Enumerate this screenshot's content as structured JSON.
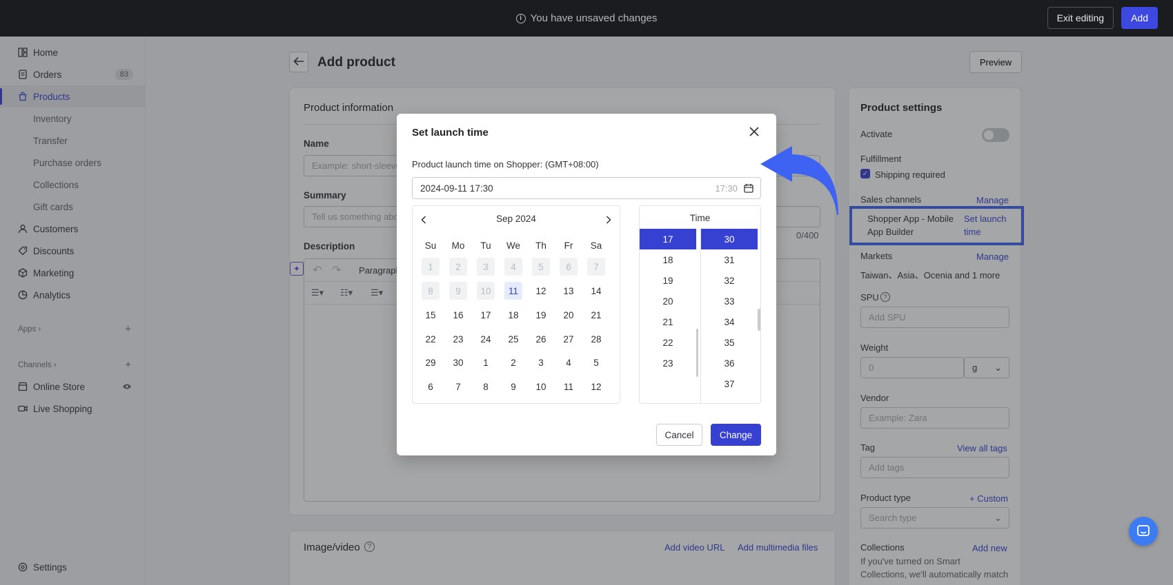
{
  "topbar": {
    "message": "You have unsaved changes",
    "exit_label": "Exit editing",
    "add_label": "Add"
  },
  "sidebar": {
    "items": [
      {
        "label": "Home",
        "icon": "home-icon"
      },
      {
        "label": "Orders",
        "icon": "orders-icon",
        "badge": "83"
      },
      {
        "label": "Products",
        "icon": "bag-icon",
        "active": true
      },
      {
        "label": "Inventory"
      },
      {
        "label": "Transfer"
      },
      {
        "label": "Purchase orders"
      },
      {
        "label": "Collections"
      },
      {
        "label": "Gift cards"
      },
      {
        "label": "Customers",
        "icon": "user-icon"
      },
      {
        "label": "Discounts",
        "icon": "tag-icon"
      },
      {
        "label": "Marketing",
        "icon": "cube-icon"
      },
      {
        "label": "Analytics",
        "icon": "chart-icon"
      }
    ],
    "apps_label": "Apps",
    "channels_label": "Channels",
    "channels": [
      {
        "label": "Online Store",
        "icon": "store-icon"
      },
      {
        "label": "Live Shopping",
        "icon": "video-icon"
      }
    ],
    "settings_label": "Settings"
  },
  "main": {
    "title": "Add product",
    "preview_label": "Preview",
    "product_info": {
      "title": "Product information",
      "name_label": "Name",
      "name_placeholder": "Example: short-sleeve",
      "summary_label": "Summary",
      "summary_placeholder": "Tell us something abo",
      "counter": "0/400",
      "description_label": "Description",
      "paragraph_label": "Paragraph"
    },
    "image_video": {
      "title": "Image/video",
      "add_video_url": "Add video URL",
      "add_multimedia": "Add multimedia files"
    }
  },
  "settings": {
    "title": "Product settings",
    "activate_label": "Activate",
    "fulfillment_label": "Fulfillment",
    "shipping_required": "Shipping required",
    "sales_channels_label": "Sales channels",
    "manage_label": "Manage",
    "channel_name_line1": "Shopper App - Mobile",
    "channel_name_line2": "App Builder",
    "set_launch_line1": "Set launch",
    "set_launch_line2": "time",
    "markets_label": "Markets",
    "markets_manage": "Manage",
    "markets_value": "Taiwan、Asia、Ocenia and 1 more",
    "spu_label": "SPU",
    "spu_placeholder": "Add SPU",
    "weight_label": "Weight",
    "weight_value": "0",
    "weight_unit": "g",
    "vendor_label": "Vendor",
    "vendor_placeholder": "Example: Zara",
    "tag_label": "Tag",
    "view_all_tags": "View all tags",
    "tag_placeholder": "Add tags",
    "product_type_label": "Product type",
    "custom_label": "+ Custom",
    "product_type_placeholder": "Search type",
    "collections_label": "Collections",
    "add_new_label": "Add new",
    "collections_text_1": "If you've turned on Smart",
    "collections_text_2": "Collections, we'll automatically match"
  },
  "modal": {
    "title": "Set launch time",
    "subtitle": "Product launch time on Shopper:  (GMT+08:00)",
    "datetime_value": "2024-09-11 17:30",
    "time_hint": "17:30",
    "month_label": "Sep  2024",
    "weekdays": [
      "Su",
      "Mo",
      "Tu",
      "We",
      "Th",
      "Fr",
      "Sa"
    ],
    "weeks": [
      [
        "1",
        "2",
        "3",
        "4",
        "5",
        "6",
        "7"
      ],
      [
        "8",
        "9",
        "10",
        "11",
        "12",
        "13",
        "14"
      ],
      [
        "15",
        "16",
        "17",
        "18",
        "19",
        "20",
        "21"
      ],
      [
        "22",
        "23",
        "24",
        "25",
        "26",
        "27",
        "28"
      ],
      [
        "29",
        "30",
        "1",
        "2",
        "3",
        "4",
        "5"
      ],
      [
        "6",
        "7",
        "8",
        "9",
        "10",
        "11",
        "12"
      ]
    ],
    "time_label": "Time",
    "hours": [
      "17",
      "18",
      "19",
      "20",
      "21",
      "22",
      "23"
    ],
    "minutes": [
      "30",
      "31",
      "32",
      "33",
      "34",
      "35",
      "36",
      "37"
    ],
    "selected_hour": "17",
    "selected_minute": "30",
    "cancel_label": "Cancel",
    "change_label": "Change"
  },
  "colors": {
    "accent": "#3641d1",
    "highlight": "#3e63f2"
  }
}
